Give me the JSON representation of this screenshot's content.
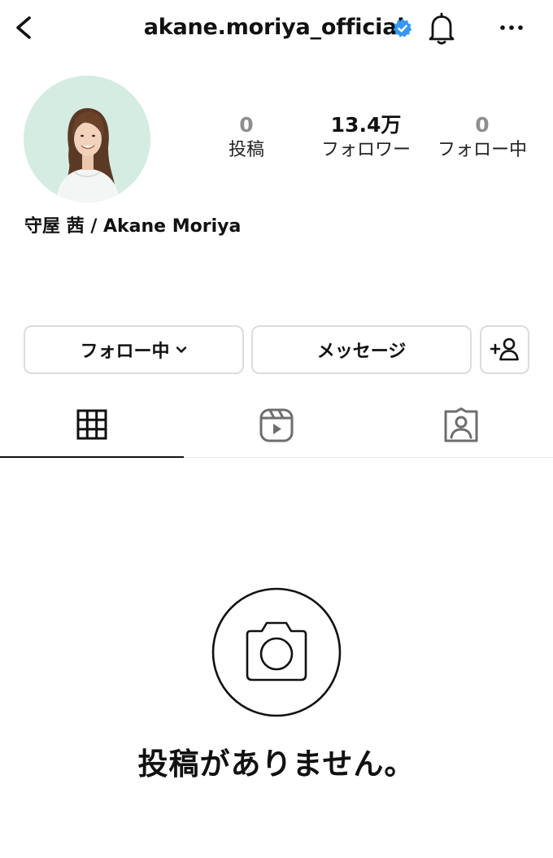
{
  "header": {
    "username": "akane.moriya_official",
    "back_icon": "chevron-left-icon",
    "verified_icon": "verified-badge-icon",
    "bell_icon": "bell-icon",
    "more_icon": "more-horizontal-icon",
    "verified_color": "#3897f0"
  },
  "profile": {
    "display_name": "守屋 茜 / Akane Moriya",
    "stats": [
      {
        "value": "0",
        "label": "投稿"
      },
      {
        "value": "13.4万",
        "label": "フォロワー"
      },
      {
        "value": "0",
        "label": "フォロー中"
      }
    ]
  },
  "actions": {
    "following_label": "フォロー中",
    "message_label": "メッセージ",
    "add_user_icon": "add-user-icon"
  },
  "tabs": [
    {
      "name": "grid",
      "icon": "grid-icon",
      "active": true
    },
    {
      "name": "reels",
      "icon": "reels-icon",
      "active": false
    },
    {
      "name": "tagged",
      "icon": "tagged-icon",
      "active": false
    }
  ],
  "empty_state": {
    "icon": "camera-icon",
    "text": "投稿がありません。"
  }
}
